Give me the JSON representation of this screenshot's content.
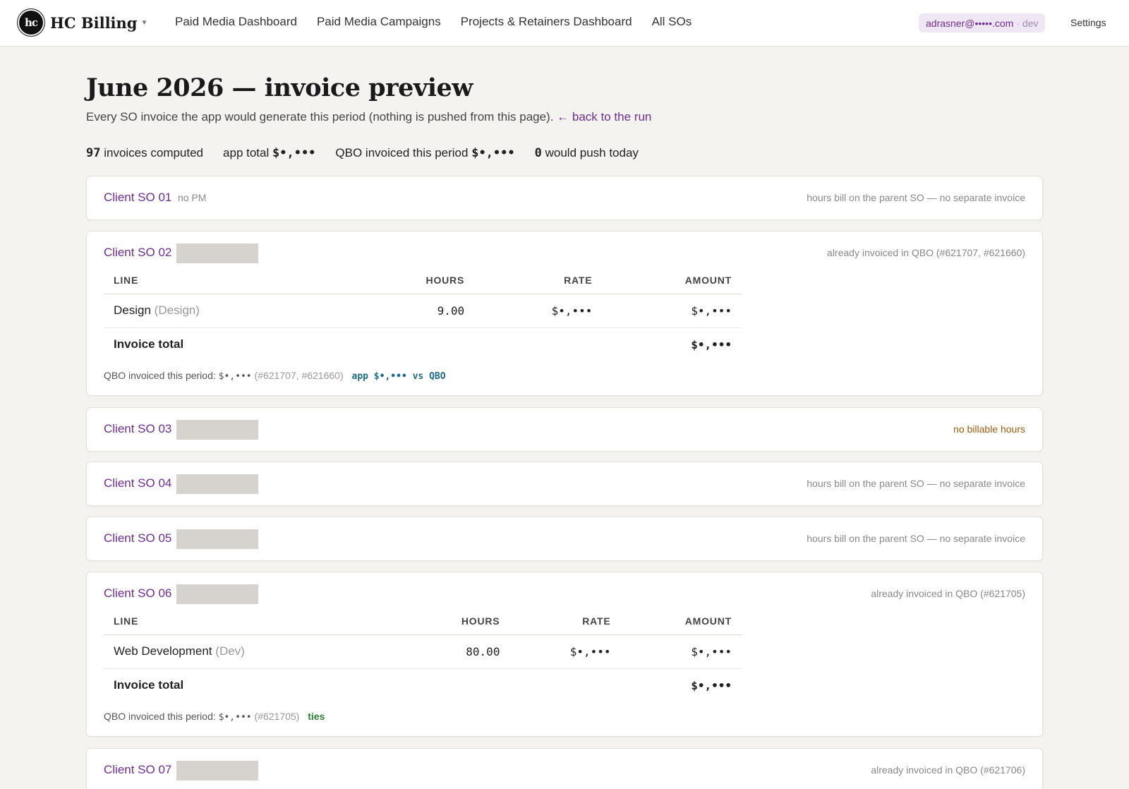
{
  "nav": {
    "brand": "HC Billing",
    "logo_text": "hc",
    "links": [
      "Paid Media Dashboard",
      "Paid Media Campaigns",
      "Projects & Retainers Dashboard",
      "All SOs"
    ],
    "user_email": "adrasner@•••••.com",
    "env": "· dev",
    "settings": "Settings"
  },
  "header": {
    "title": "June 2026 — invoice preview",
    "subtitle": "Every SO invoice the app would generate this period (nothing is pushed from this page).",
    "back_link": "← back to the run"
  },
  "stats": {
    "invoices_count": "97",
    "invoices_label": "invoices computed",
    "app_total_label": "app total",
    "app_total": "$•,•••",
    "qbo_label": "QBO invoiced this period",
    "qbo_total": "$•,•••",
    "push_count": "0",
    "push_label": "would push today"
  },
  "table_headers": {
    "line": "LINE",
    "hours": "HOURS",
    "rate": "RATE",
    "amount": "AMOUNT"
  },
  "total_label": "Invoice total",
  "qbo_prefix": "QBO invoiced this period:",
  "cards": [
    {
      "name": "Client SO 01",
      "sub": "no PM",
      "status": "hours bill on the parent SO — no separate invoice"
    },
    {
      "name": "Client SO 02",
      "status": "already invoiced in QBO (#621707, #621660)",
      "line": {
        "label": "Design",
        "category": "(Design)",
        "hours": "9.00",
        "rate": "$•,•••",
        "amount": "$•,•••"
      },
      "total": "$•,•••",
      "qbo_amount": "$•,•••",
      "qbo_refs": "(#621707, #621660)",
      "compare": "app $•,••• vs QBO"
    },
    {
      "name": "Client SO 03",
      "status": "no billable hours"
    },
    {
      "name": "Client SO 04",
      "status": "hours bill on the parent SO — no separate invoice"
    },
    {
      "name": "Client SO 05",
      "status": "hours bill on the parent SO — no separate invoice"
    },
    {
      "name": "Client SO 06",
      "status": "already invoiced in QBO (#621705)",
      "line": {
        "label": "Web Development",
        "category": "(Dev)",
        "hours": "80.00",
        "rate": "$•,•••",
        "amount": "$•,•••"
      },
      "total": "$•,•••",
      "qbo_amount": "$•,•••",
      "qbo_refs": "(#621705)",
      "compare": "ties"
    },
    {
      "name": "Client SO 07",
      "status": "already invoiced in QBO (#621706)"
    }
  ]
}
